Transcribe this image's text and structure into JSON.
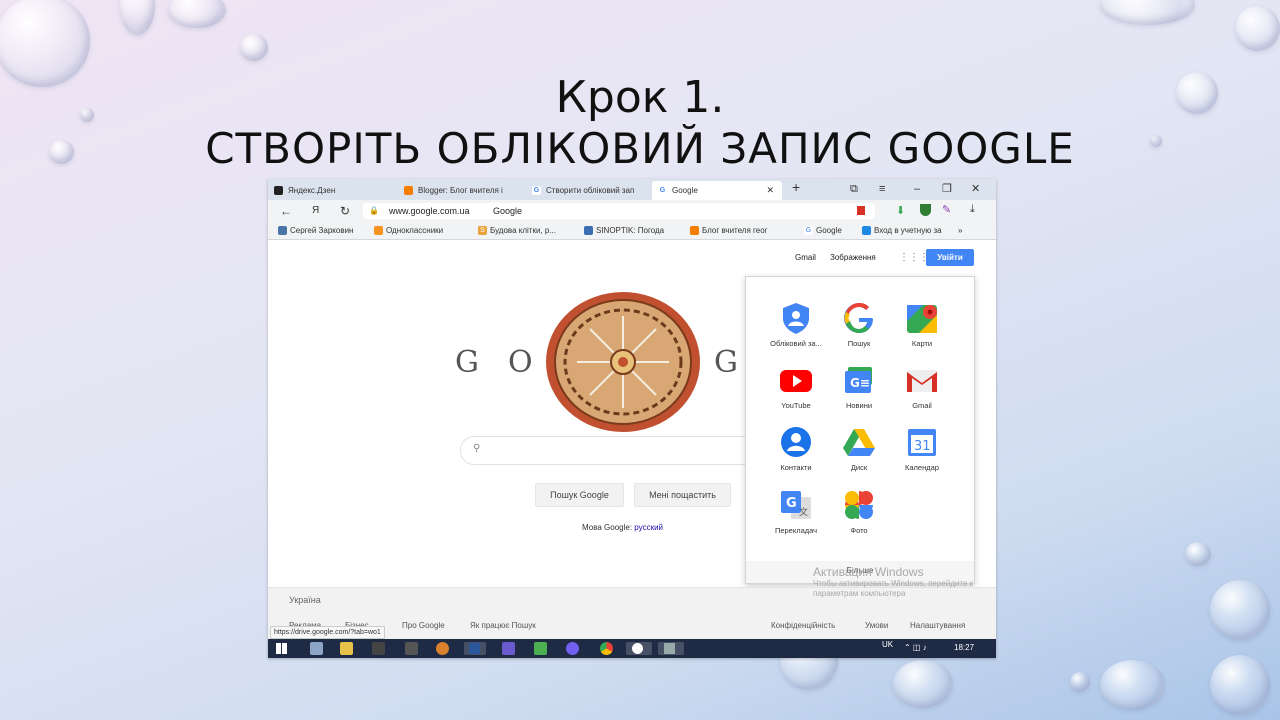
{
  "slide": {
    "title_line1": "Крок 1.",
    "title_line2": "СТВОРІТЬ ОБЛІКОВИЙ ЗАПИС GOOGLE"
  },
  "browser": {
    "tabs": [
      {
        "label": "Яндекс.Дзен",
        "favicon": "yandex-zen-icon"
      },
      {
        "label": "Blogger: Блог вчителя і",
        "favicon": "blogger-icon"
      },
      {
        "label": "Створити обліковий зап",
        "favicon": "google-icon"
      },
      {
        "label": "Google",
        "favicon": "google-icon"
      }
    ],
    "yandex_button": "Я",
    "url_domain": "www.google.com.ua",
    "url_title": "Google",
    "bookmarks": [
      "Сергей Зарковин",
      "Одноклассники",
      "Будова клітки, р...",
      "SINOPTIK: Погода",
      "Блог вчителя геог",
      "Google",
      "Вход в учетную за"
    ]
  },
  "google": {
    "top_links": {
      "gmail": "Gmail",
      "images": "Зображення"
    },
    "sign_in": "Увійти",
    "search_button": "Пошук Google",
    "lucky_button": "Мені пощастить",
    "language_prefix": "Мова Google:",
    "language_link": "русский",
    "apps": [
      {
        "label": "Обліковий за...",
        "icon": "account-icon"
      },
      {
        "label": "Пошук",
        "icon": "google-search-icon"
      },
      {
        "label": "Карти",
        "icon": "maps-icon"
      },
      {
        "label": "YouTube",
        "icon": "youtube-icon"
      },
      {
        "label": "Новини",
        "icon": "news-icon"
      },
      {
        "label": "Gmail",
        "icon": "gmail-icon"
      },
      {
        "label": "Контакти",
        "icon": "contacts-icon"
      },
      {
        "label": "Диск",
        "icon": "drive-icon"
      },
      {
        "label": "Календар",
        "icon": "calendar-icon"
      },
      {
        "label": "Перекладач",
        "icon": "translate-icon"
      },
      {
        "label": "Фото",
        "icon": "photos-icon"
      }
    ],
    "calendar_day": "31",
    "apps_more": "Більше",
    "footer": {
      "country": "Україна",
      "left_links": [
        "Реклама",
        "Бізнес",
        "Про Google",
        "Як працює Пошук"
      ],
      "right_links": [
        "Конфіденційність",
        "Умови",
        "Налаштування"
      ]
    },
    "status_url": "https://drive.google.com/?tab=wo1"
  },
  "windows": {
    "watermark_title": "Активация Windows",
    "watermark_text": "Чтобы активировать Windows, перейдите к параметрам компьютера",
    "lang": "UK",
    "time": "18:27"
  },
  "colors": {
    "google_blue": "#4285f4",
    "google_red": "#ea4335",
    "google_yellow": "#fbbc05",
    "google_green": "#34a853",
    "taskbar": "#1f2a44"
  }
}
